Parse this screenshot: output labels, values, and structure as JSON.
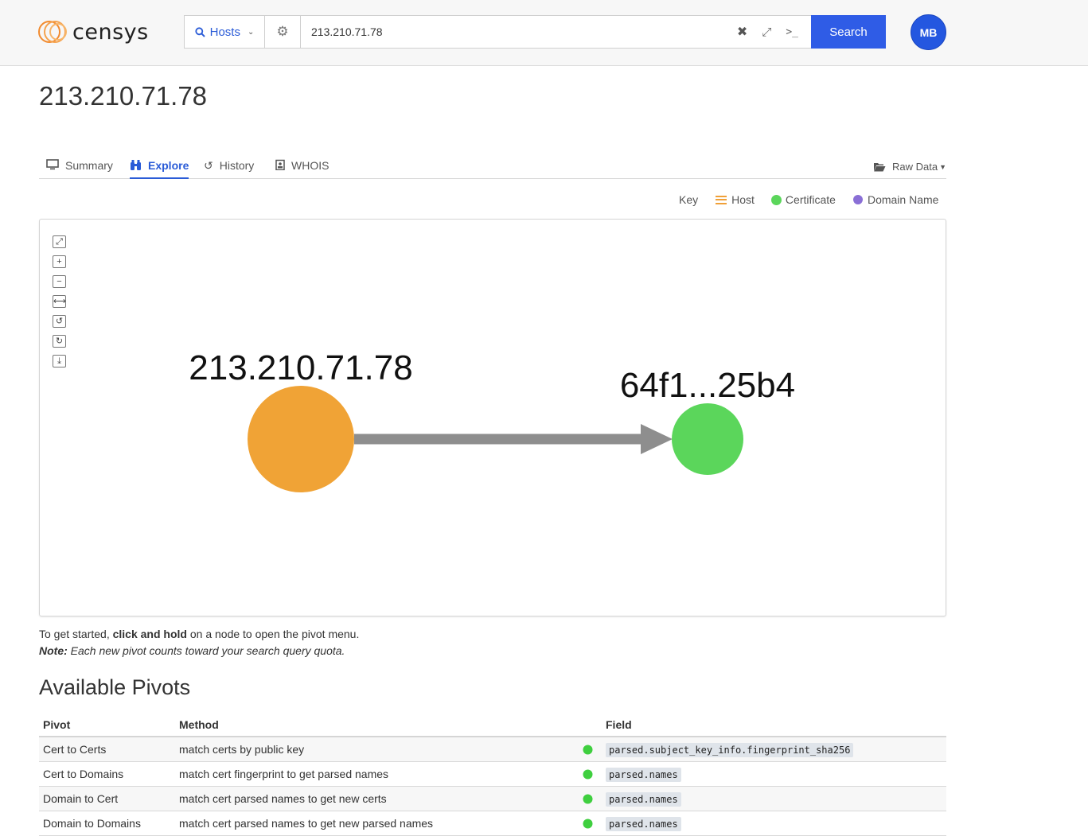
{
  "header": {
    "logo_text": "censys",
    "search_type": "Hosts",
    "search_value": "213.210.71.78",
    "search_button": "Search",
    "avatar_initials": "MB",
    "console_glyph": ">_"
  },
  "page": {
    "title": "213.210.71.78"
  },
  "tabs": [
    {
      "label": "Summary",
      "icon": "monitor-icon",
      "active": false
    },
    {
      "label": "Explore",
      "icon": "binoculars-icon",
      "active": true
    },
    {
      "label": "History",
      "icon": "history-icon",
      "active": false
    },
    {
      "label": "WHOIS",
      "icon": "id-badge-icon",
      "active": false
    }
  ],
  "raw_data_label": "Raw Data",
  "legend": {
    "key_label": "Key",
    "items": [
      {
        "label": "Host",
        "icon": "host-icon",
        "color": "#f0a038"
      },
      {
        "label": "Certificate",
        "icon": "certificate-icon",
        "color": "#5bd65b"
      },
      {
        "label": "Domain Name",
        "icon": "globe-icon",
        "color": "#8a6fd6"
      }
    ]
  },
  "graph": {
    "tools": [
      "expand-icon",
      "zoom-in-icon",
      "zoom-out-icon",
      "fit-width-icon",
      "undo-icon",
      "redo-icon",
      "download-icon"
    ],
    "nodes": [
      {
        "label": "213.210.71.78",
        "type": "host",
        "color": "#f0a336"
      },
      {
        "label": "64f1...25b4",
        "type": "certificate",
        "color": "#5bd65b"
      }
    ],
    "edge_color": "#8e8e8e"
  },
  "hint": {
    "line1_a": "To get started, ",
    "line1_b": "click and hold",
    "line1_c": " on a node to open the pivot menu.",
    "note_label": "Note:",
    "note_text": " Each new pivot counts toward your search query quota."
  },
  "pivots": {
    "title": "Available Pivots",
    "headers": {
      "pivot": "Pivot",
      "method": "Method",
      "field": "Field"
    },
    "rows": [
      {
        "pivot": "Cert to Certs",
        "method": "match certs by public key",
        "field": "parsed.subject_key_info.fingerprint_sha256"
      },
      {
        "pivot": "Cert to Domains",
        "method": "match cert fingerprint to get parsed names",
        "field": "parsed.names"
      },
      {
        "pivot": "Domain to Cert",
        "method": "match cert parsed names to get new certs",
        "field": "parsed.names"
      },
      {
        "pivot": "Domain to Domains",
        "method": "match cert parsed names to get new parsed names",
        "field": "parsed.names"
      }
    ]
  }
}
